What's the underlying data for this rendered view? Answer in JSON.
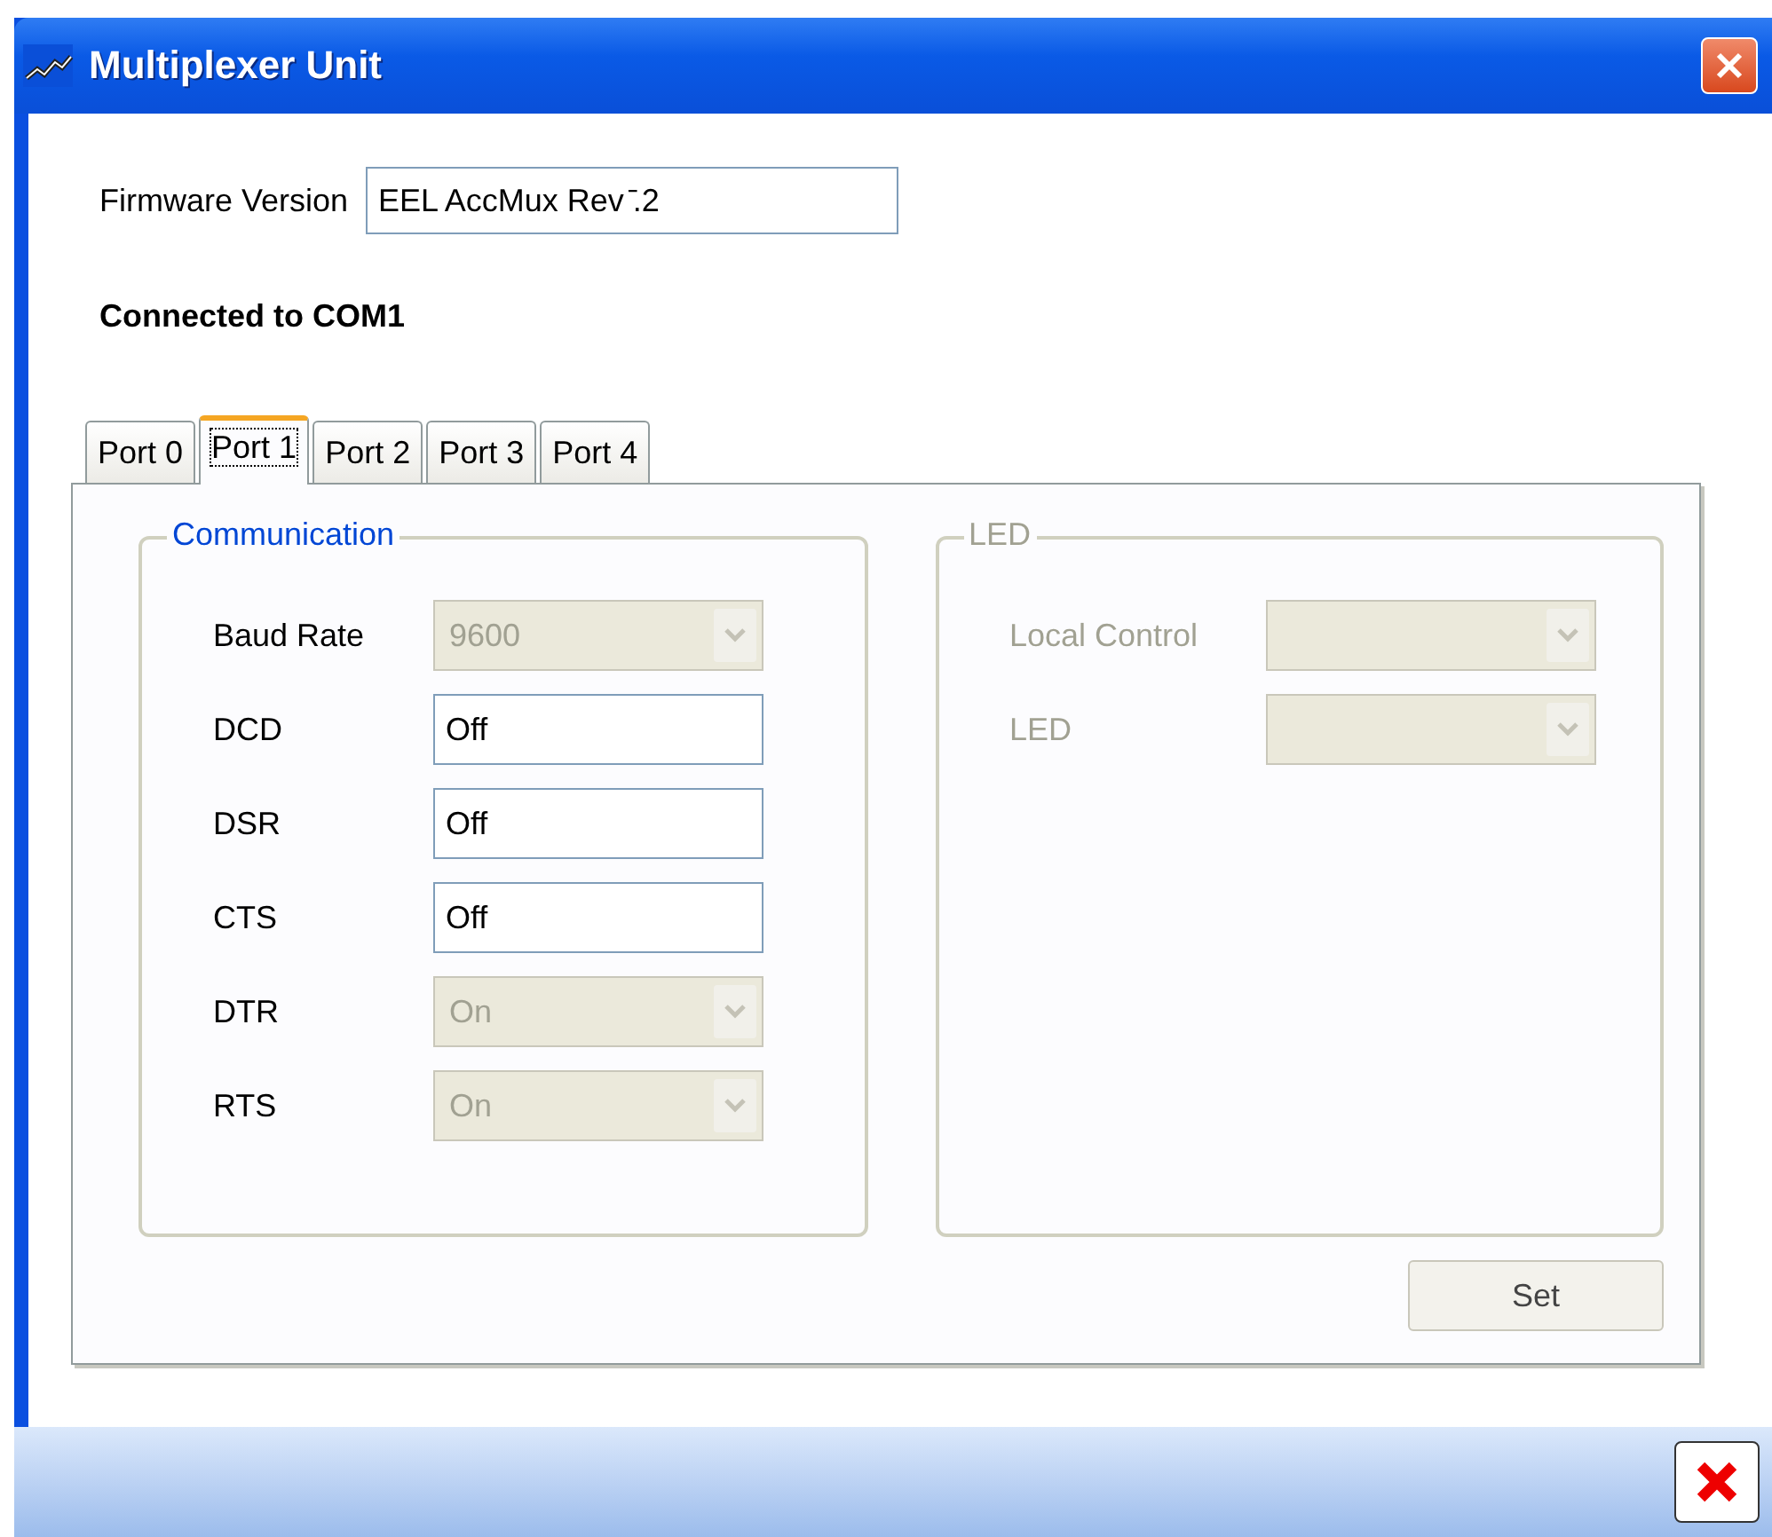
{
  "window": {
    "title": "Multiplexer Unit"
  },
  "firmware": {
    "label": "Firmware Version",
    "value": "EEL AccMux Rev ̄.2"
  },
  "connection_status": "Connected to COM1",
  "tabs": [
    {
      "label": "Port 0",
      "selected": false
    },
    {
      "label": "Port 1",
      "selected": true
    },
    {
      "label": "Port 2",
      "selected": false
    },
    {
      "label": "Port 3",
      "selected": false
    },
    {
      "label": "Port 4",
      "selected": false
    }
  ],
  "groups": [
    {
      "title": "Communication",
      "disabled": false,
      "fields": [
        {
          "label": "Baud Rate",
          "kind": "combo",
          "value": "9600",
          "disabled": true
        },
        {
          "label": "DCD",
          "kind": "text",
          "value": "Off",
          "disabled": false
        },
        {
          "label": "DSR",
          "kind": "text",
          "value": "Off",
          "disabled": false
        },
        {
          "label": "CTS",
          "kind": "text",
          "value": "Off",
          "disabled": false
        },
        {
          "label": "DTR",
          "kind": "combo",
          "value": "On",
          "disabled": true
        },
        {
          "label": "RTS",
          "kind": "combo",
          "value": "On",
          "disabled": true
        }
      ]
    },
    {
      "title": "LED",
      "disabled": true,
      "fields": [
        {
          "label": "Local Control",
          "kind": "combo",
          "disabled": true
        },
        {
          "label": "LED",
          "kind": "combo",
          "disabled": true
        }
      ]
    }
  ],
  "set_button": {
    "label": "Set"
  }
}
